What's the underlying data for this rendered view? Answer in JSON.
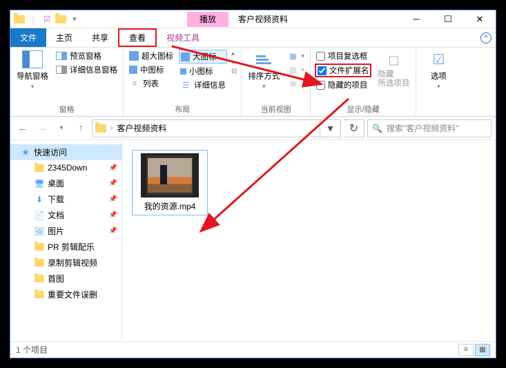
{
  "titlebar": {
    "play_tab": "播放",
    "title": "客户视频资料"
  },
  "tabs": {
    "file": "文件",
    "home": "主页",
    "share": "共享",
    "view": "查看",
    "video_tools": "视频工具"
  },
  "ribbon": {
    "panes": {
      "nav_pane": "导航窗格",
      "preview_pane": "预览窗格",
      "details_pane": "详细信息窗格",
      "group": "窗格"
    },
    "layout": {
      "extra_large": "超大图标",
      "large": "大图标",
      "medium": "中图标",
      "small": "小图标",
      "list": "列表",
      "details": "详细信息",
      "group": "布局"
    },
    "current_view": {
      "sort_by": "排序方式",
      "group": "当前视图"
    },
    "show_hide": {
      "item_checkboxes": "项目复选框",
      "file_ext": "文件扩展名",
      "hidden_items": "隐藏的项目",
      "hide_selected": "隐藏\n所选项目",
      "group": "显示/隐藏"
    },
    "options": {
      "options": "选项"
    }
  },
  "addressbar": {
    "location": "客户视频资料",
    "search_placeholder": "搜索\"客户视频资料\""
  },
  "sidebar": {
    "quick_access": "快速访问",
    "items": [
      "2345Down",
      "桌面",
      "下载",
      "文档",
      "图片",
      "PR 剪辑配乐",
      "录制剪辑视频",
      "首图",
      "重要文件误删"
    ]
  },
  "files": {
    "item1": "我的资源.mp4"
  },
  "statusbar": {
    "count": "1 个项目"
  }
}
